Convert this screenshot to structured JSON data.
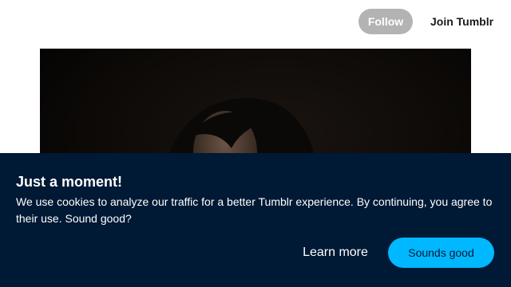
{
  "header": {
    "follow_label": "Follow",
    "join_label": "Join Tumblr"
  },
  "post": {
    "image_icon": "photo-icon"
  },
  "cookie_banner": {
    "title": "Just a moment!",
    "message": "We use cookies to analyze our traffic for a better Tumblr experience. By continuing, you agree to their use. Sound good?",
    "learn_more_label": "Learn more",
    "accept_label": "Sounds good"
  },
  "colors": {
    "banner_background": "#001935",
    "accept_button": "#00b8ff",
    "follow_button": "#b3b3b3"
  }
}
